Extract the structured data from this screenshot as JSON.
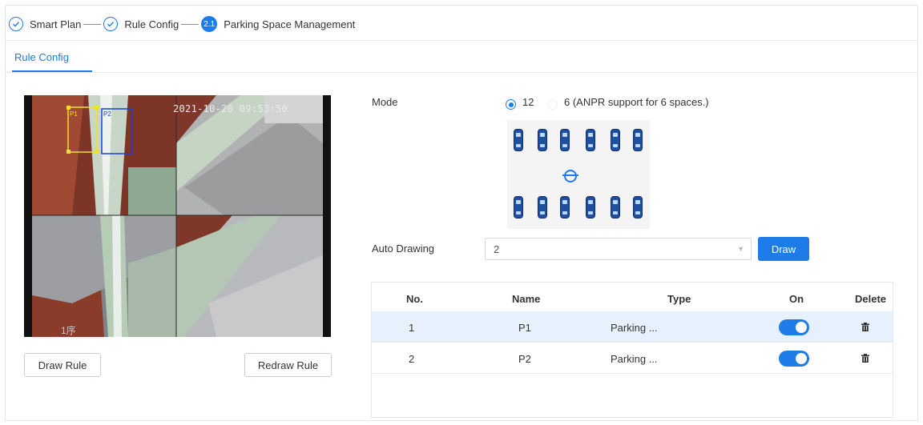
{
  "steps": [
    {
      "label": "Smart Plan",
      "state": "done"
    },
    {
      "label": "Rule Config",
      "state": "done"
    },
    {
      "label": "Parking Space Management",
      "state": "active",
      "number": "2.1"
    }
  ],
  "tabs": [
    {
      "label": "Rule Config",
      "active": true
    }
  ],
  "video": {
    "timestamp": "2021-10-20 09:53:50",
    "channel_label": "1序",
    "zones": [
      "P1",
      "P2"
    ]
  },
  "buttons": {
    "draw_rule": "Draw Rule",
    "redraw_rule": "Redraw Rule",
    "draw": "Draw"
  },
  "mode": {
    "label": "Mode",
    "options": [
      {
        "label": "12",
        "selected": true
      },
      {
        "label": "6 (ANPR support for 6 spaces.)",
        "selected": false
      }
    ],
    "lot_icon": "parking-layout-diagram"
  },
  "auto_drawing": {
    "label": "Auto Drawing",
    "value": "2"
  },
  "table": {
    "columns": [
      "No.",
      "Name",
      "Type",
      "On",
      "Delete"
    ],
    "rows": [
      {
        "no": "1",
        "name": "P1",
        "type": "Parking ...",
        "on": true,
        "highlighted": true
      },
      {
        "no": "2",
        "name": "P2",
        "type": "Parking ...",
        "on": true,
        "highlighted": false
      }
    ]
  },
  "colors": {
    "accent": "#1d7ce8",
    "row_highlight": "#e6f1fd",
    "zone_p1": "#f2e21a",
    "zone_p2": "#1a3fd0"
  }
}
